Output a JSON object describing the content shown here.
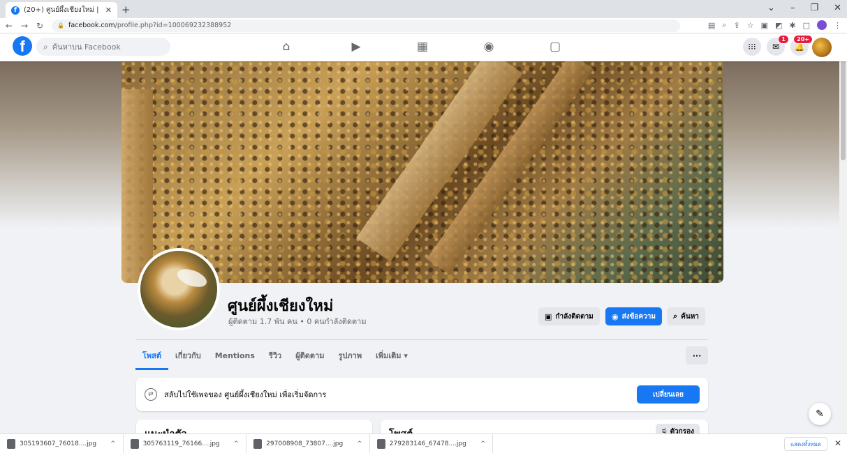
{
  "browser": {
    "tab_title": "(20+) ศูนย์ผึ้งเชียงใหม่ | Facebook",
    "url_domain": "facebook.com",
    "url_path": "/profile.php?id=100069232388952"
  },
  "header": {
    "search_placeholder": "ค้นหาบน Facebook",
    "messenger_badge": "1",
    "notifications_badge": "20+"
  },
  "page": {
    "name": "ศูนย์ผึ้งเชียงใหม่",
    "subtitle": "ผู้ติดตาม 1.7 พัน คน • 0 คนกำลังติดตาม",
    "buttons": {
      "following": "กำลังติดตาม",
      "message": "ส่งข้อความ",
      "search": "ค้นหา"
    },
    "tabs": [
      "โพสต์",
      "เกี่ยวกับ",
      "Mentions",
      "รีวิว",
      "ผู้ติดตาม",
      "รูปภาพ",
      "เพิ่มเติม ▾"
    ]
  },
  "switch_card": {
    "text": "สลับไปใช้เพจของ ศูนย์ผึ้งเชียงใหม่ เพื่อเริ่มจัดการ",
    "button": "เปลี่ยนเลย"
  },
  "intro_card": {
    "title": "แนะนำตัว"
  },
  "posts_card": {
    "title": "โพสต์",
    "filter": "ตัวกรอง"
  },
  "downloads": {
    "items": [
      "305193607_76018....jpg",
      "305763119_76166....jpg",
      "297008908_73807....jpg",
      "279283146_67478....jpg"
    ],
    "show_all": "แสดงทั้งหมด"
  },
  "colors": {
    "fb_blue": "#1877f2",
    "badge_red": "#e41e3f"
  }
}
